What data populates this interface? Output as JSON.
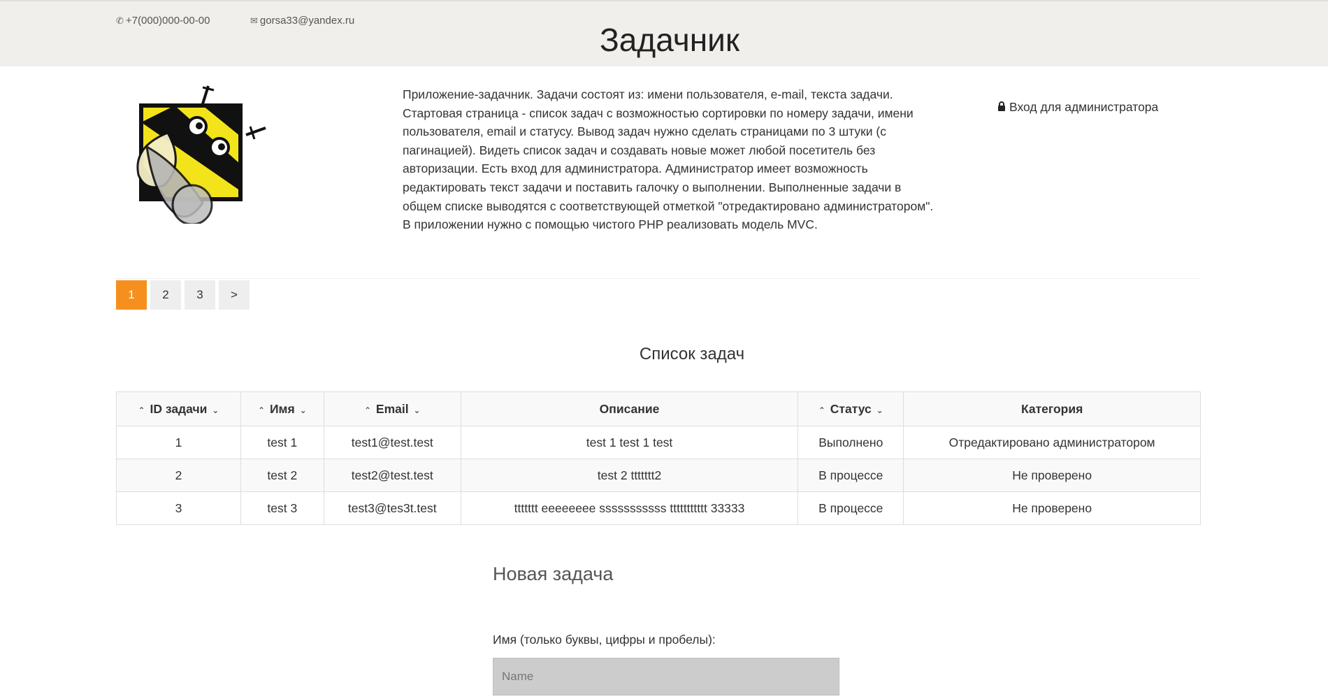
{
  "header": {
    "phone": "+7(000)000-00-00",
    "email": "gorsa33@yandex.ru",
    "title": "Задачник"
  },
  "description": "Приложение-задачник. Задачи состоят из: имени пользователя, e-mail, текста задачи. Стартовая страница - список задач с возможностью сортировки по номеру задачи, имени пользователя, email и статусу. Вывод задач нужно сделать страницами по 3 штуки (с пагинацией). Видеть список задач и создавать новые может любой посетитель без авторизации. Есть вход для администратора. Администратор имеет возможность редактировать текст задачи и поставить галочку о выполнении. Выполненные задачи в общем списке выводятся с соответствующей отметкой \"отредактировано администратором\". В приложении нужно с помощью чистого PHP реализовать модель MVC.",
  "admin_login": "Вход для администратора",
  "pagination": {
    "pages": [
      "1",
      "2",
      "3"
    ],
    "next": ">",
    "current": "1"
  },
  "list_title": "Список задач",
  "table": {
    "columns": [
      "ID задачи",
      "Имя",
      "Email",
      "Описание",
      "Статус",
      "Категория"
    ],
    "rows": [
      [
        "1",
        "test 1",
        "test1@test.test",
        "test 1 test 1 test",
        "Выполнено",
        "Отредактировано администратором"
      ],
      [
        "2",
        "test 2",
        "test2@test.test",
        "test 2 ttttttt2",
        "В процессе",
        "Не проверено"
      ],
      [
        "3",
        "test 3",
        "test3@tes3t.test",
        "ttttttt eeeeeeee sssssssssss ttttttttttt 33333",
        "В процессе",
        "Не проверено"
      ]
    ]
  },
  "new_task": {
    "title": "Новая задача",
    "name_label": "Имя (только буквы, цифры и пробелы):",
    "name_placeholder": "Name",
    "name_value": ""
  },
  "colors": {
    "accent": "#f5901e",
    "header_bg": "#f0efeb",
    "logo_yellow": "#f3e31b"
  },
  "icons": {
    "phone": "phone-icon",
    "email": "envelope-icon",
    "admin": "lock-icon",
    "sort_up": "sort-asc-icon",
    "sort_down": "sort-desc-icon"
  }
}
